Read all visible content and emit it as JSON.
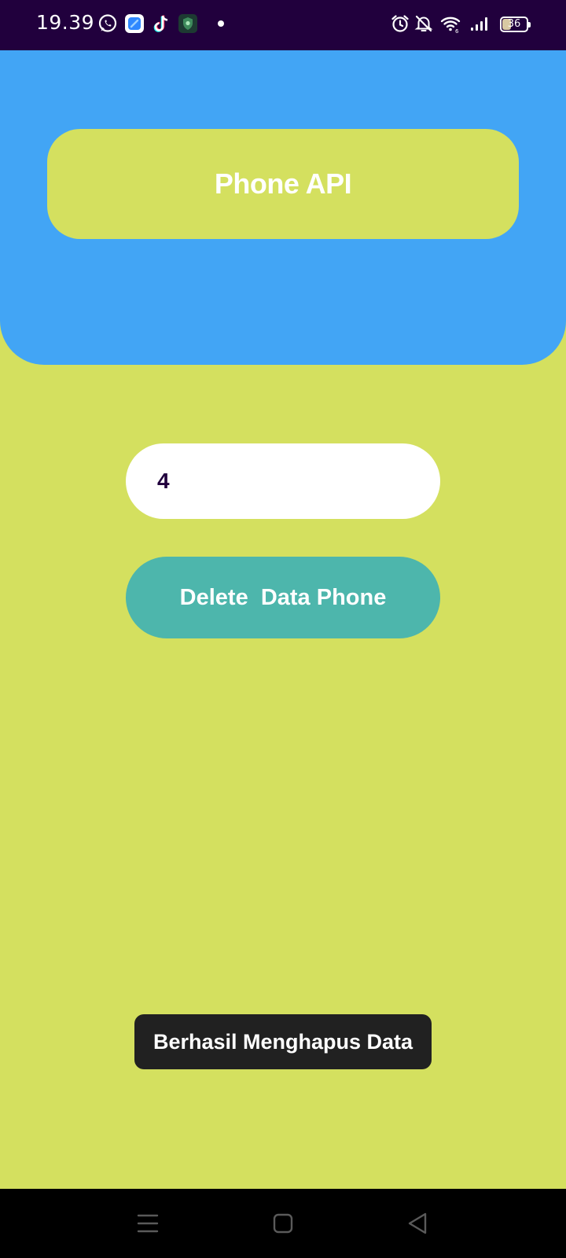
{
  "status_bar": {
    "time": "19.39",
    "battery_level": "36",
    "notification_icons": [
      "whatsapp-icon",
      "messenger-app-icon",
      "tiktok-icon",
      "shield-app-icon",
      "notification-dot-icon"
    ],
    "system_icons": [
      "alarm-icon",
      "notifications-off-icon",
      "wifi-icon",
      "signal-icon",
      "battery-icon"
    ]
  },
  "header": {
    "title": "Phone API"
  },
  "form": {
    "id_value": "4"
  },
  "actions": {
    "delete_label": "Delete  Data Phone"
  },
  "toast": {
    "message": "Berhasil Menghapus Data"
  },
  "nav": {
    "buttons": [
      "menu-icon",
      "home-icon",
      "back-icon"
    ]
  },
  "colors": {
    "status_bar": "#21003d",
    "header": "#42a5f5",
    "background": "#d4e05f",
    "button": "#4db6ac",
    "toast": "#212121",
    "nav_bar": "#000000"
  }
}
